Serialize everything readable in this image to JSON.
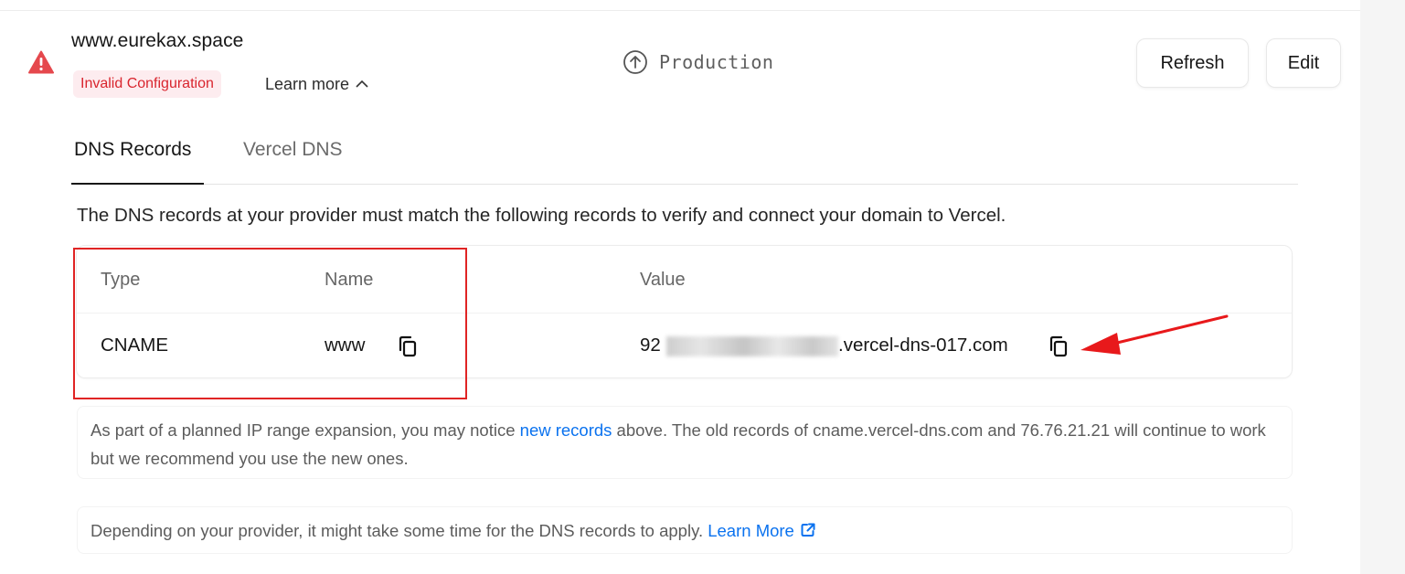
{
  "domain": {
    "name": "www.eurekax.space",
    "status": "Invalid Configuration",
    "learn_more": "Learn more",
    "environment": "Production"
  },
  "actions": {
    "refresh": "Refresh",
    "edit": "Edit"
  },
  "tabs": [
    {
      "label": "DNS Records",
      "active": true
    },
    {
      "label": "Vercel DNS",
      "active": false
    }
  ],
  "intro": "The DNS records at your provider must match the following records to verify and connect your domain to Vercel.",
  "table": {
    "headers": {
      "type": "Type",
      "name": "Name",
      "value": "Value"
    },
    "rows": [
      {
        "type": "CNAME",
        "name": "www",
        "value_prefix": "92",
        "value_suffix": ".vercel-dns-017.com"
      }
    ]
  },
  "notices": {
    "ip_expansion": {
      "before": "As part of a planned IP range expansion, you may notice ",
      "link": "new records",
      "after": " above. The old records of cname.vercel-dns.com and 76.76.21.21 will continue to work but we recommend you use the new ones."
    },
    "propagation": {
      "text": "Depending on your provider, it might take some time for the DNS records to apply. ",
      "link": "Learn More"
    }
  },
  "icons": {
    "warning": "warning-icon",
    "chevron": "chevron-up-icon",
    "environment": "arrow-up-circle-icon",
    "copy": "copy-icon",
    "external": "external-link-icon"
  },
  "colors": {
    "danger": "#d9252e",
    "danger_bg": "#fdecef",
    "link": "#0a72ef",
    "annotation": "#e02424"
  }
}
